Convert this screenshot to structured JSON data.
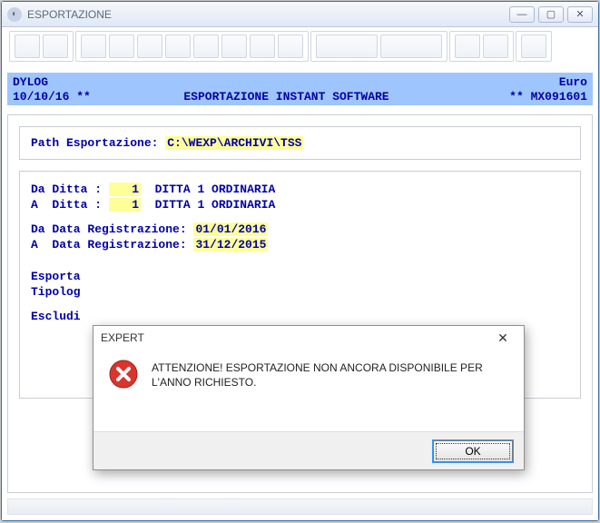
{
  "window": {
    "title": "ESPORTAZIONE",
    "min_glyph": "—",
    "max_glyph": "▢",
    "close_glyph": "✕"
  },
  "banner": {
    "company": "DYLOG",
    "currency": "Euro",
    "date_line": "10/10/16   **",
    "title": "ESPORTAZIONE INSTANT SOFTWARE",
    "code_line": "**  MX091601"
  },
  "form": {
    "path_label": "Path Esportazione: ",
    "path_value": "C:\\WEXP\\ARCHIVI\\TSS    ",
    "da_ditta_label": "Da Ditta : ",
    "da_ditta_num": "   1",
    "da_ditta_name": "  DITTA 1 ORDINARIA",
    "a_ditta_label": "A  Ditta : ",
    "a_ditta_num": "   1",
    "a_ditta_name": "  DITTA 1 ORDINARIA",
    "da_data_label": "Da Data Registrazione: ",
    "da_data_value": "01/01/2016",
    "a_data_label": "A  Data Registrazione: ",
    "a_data_value": "31/12/2015",
    "esporta_label": "Esporta",
    "tipolog_label": "Tipolog",
    "escludi_label": "Escludi"
  },
  "dialog": {
    "title": "EXPERT",
    "close_glyph": "✕",
    "message": "ATTENZIONE! ESPORTAZIONE NON ANCORA DISPONIBILE PER L'ANNO RICHIESTO.",
    "ok_label": "OK"
  }
}
